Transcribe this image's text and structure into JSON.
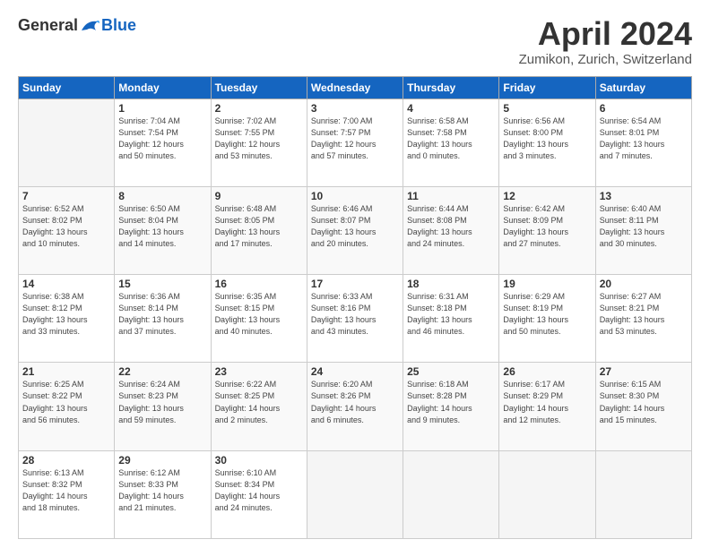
{
  "logo": {
    "general": "General",
    "blue": "Blue"
  },
  "title": "April 2024",
  "subtitle": "Zumikon, Zurich, Switzerland",
  "days": [
    "Sunday",
    "Monday",
    "Tuesday",
    "Wednesday",
    "Thursday",
    "Friday",
    "Saturday"
  ],
  "weeks": [
    [
      {
        "day": "",
        "info": ""
      },
      {
        "day": "1",
        "info": "Sunrise: 7:04 AM\nSunset: 7:54 PM\nDaylight: 12 hours\nand 50 minutes."
      },
      {
        "day": "2",
        "info": "Sunrise: 7:02 AM\nSunset: 7:55 PM\nDaylight: 12 hours\nand 53 minutes."
      },
      {
        "day": "3",
        "info": "Sunrise: 7:00 AM\nSunset: 7:57 PM\nDaylight: 12 hours\nand 57 minutes."
      },
      {
        "day": "4",
        "info": "Sunrise: 6:58 AM\nSunset: 7:58 PM\nDaylight: 13 hours\nand 0 minutes."
      },
      {
        "day": "5",
        "info": "Sunrise: 6:56 AM\nSunset: 8:00 PM\nDaylight: 13 hours\nand 3 minutes."
      },
      {
        "day": "6",
        "info": "Sunrise: 6:54 AM\nSunset: 8:01 PM\nDaylight: 13 hours\nand 7 minutes."
      }
    ],
    [
      {
        "day": "7",
        "info": "Sunrise: 6:52 AM\nSunset: 8:02 PM\nDaylight: 13 hours\nand 10 minutes."
      },
      {
        "day": "8",
        "info": "Sunrise: 6:50 AM\nSunset: 8:04 PM\nDaylight: 13 hours\nand 14 minutes."
      },
      {
        "day": "9",
        "info": "Sunrise: 6:48 AM\nSunset: 8:05 PM\nDaylight: 13 hours\nand 17 minutes."
      },
      {
        "day": "10",
        "info": "Sunrise: 6:46 AM\nSunset: 8:07 PM\nDaylight: 13 hours\nand 20 minutes."
      },
      {
        "day": "11",
        "info": "Sunrise: 6:44 AM\nSunset: 8:08 PM\nDaylight: 13 hours\nand 24 minutes."
      },
      {
        "day": "12",
        "info": "Sunrise: 6:42 AM\nSunset: 8:09 PM\nDaylight: 13 hours\nand 27 minutes."
      },
      {
        "day": "13",
        "info": "Sunrise: 6:40 AM\nSunset: 8:11 PM\nDaylight: 13 hours\nand 30 minutes."
      }
    ],
    [
      {
        "day": "14",
        "info": "Sunrise: 6:38 AM\nSunset: 8:12 PM\nDaylight: 13 hours\nand 33 minutes."
      },
      {
        "day": "15",
        "info": "Sunrise: 6:36 AM\nSunset: 8:14 PM\nDaylight: 13 hours\nand 37 minutes."
      },
      {
        "day": "16",
        "info": "Sunrise: 6:35 AM\nSunset: 8:15 PM\nDaylight: 13 hours\nand 40 minutes."
      },
      {
        "day": "17",
        "info": "Sunrise: 6:33 AM\nSunset: 8:16 PM\nDaylight: 13 hours\nand 43 minutes."
      },
      {
        "day": "18",
        "info": "Sunrise: 6:31 AM\nSunset: 8:18 PM\nDaylight: 13 hours\nand 46 minutes."
      },
      {
        "day": "19",
        "info": "Sunrise: 6:29 AM\nSunset: 8:19 PM\nDaylight: 13 hours\nand 50 minutes."
      },
      {
        "day": "20",
        "info": "Sunrise: 6:27 AM\nSunset: 8:21 PM\nDaylight: 13 hours\nand 53 minutes."
      }
    ],
    [
      {
        "day": "21",
        "info": "Sunrise: 6:25 AM\nSunset: 8:22 PM\nDaylight: 13 hours\nand 56 minutes."
      },
      {
        "day": "22",
        "info": "Sunrise: 6:24 AM\nSunset: 8:23 PM\nDaylight: 13 hours\nand 59 minutes."
      },
      {
        "day": "23",
        "info": "Sunrise: 6:22 AM\nSunset: 8:25 PM\nDaylight: 14 hours\nand 2 minutes."
      },
      {
        "day": "24",
        "info": "Sunrise: 6:20 AM\nSunset: 8:26 PM\nDaylight: 14 hours\nand 6 minutes."
      },
      {
        "day": "25",
        "info": "Sunrise: 6:18 AM\nSunset: 8:28 PM\nDaylight: 14 hours\nand 9 minutes."
      },
      {
        "day": "26",
        "info": "Sunrise: 6:17 AM\nSunset: 8:29 PM\nDaylight: 14 hours\nand 12 minutes."
      },
      {
        "day": "27",
        "info": "Sunrise: 6:15 AM\nSunset: 8:30 PM\nDaylight: 14 hours\nand 15 minutes."
      }
    ],
    [
      {
        "day": "28",
        "info": "Sunrise: 6:13 AM\nSunset: 8:32 PM\nDaylight: 14 hours\nand 18 minutes."
      },
      {
        "day": "29",
        "info": "Sunrise: 6:12 AM\nSunset: 8:33 PM\nDaylight: 14 hours\nand 21 minutes."
      },
      {
        "day": "30",
        "info": "Sunrise: 6:10 AM\nSunset: 8:34 PM\nDaylight: 14 hours\nand 24 minutes."
      },
      {
        "day": "",
        "info": ""
      },
      {
        "day": "",
        "info": ""
      },
      {
        "day": "",
        "info": ""
      },
      {
        "day": "",
        "info": ""
      }
    ]
  ]
}
